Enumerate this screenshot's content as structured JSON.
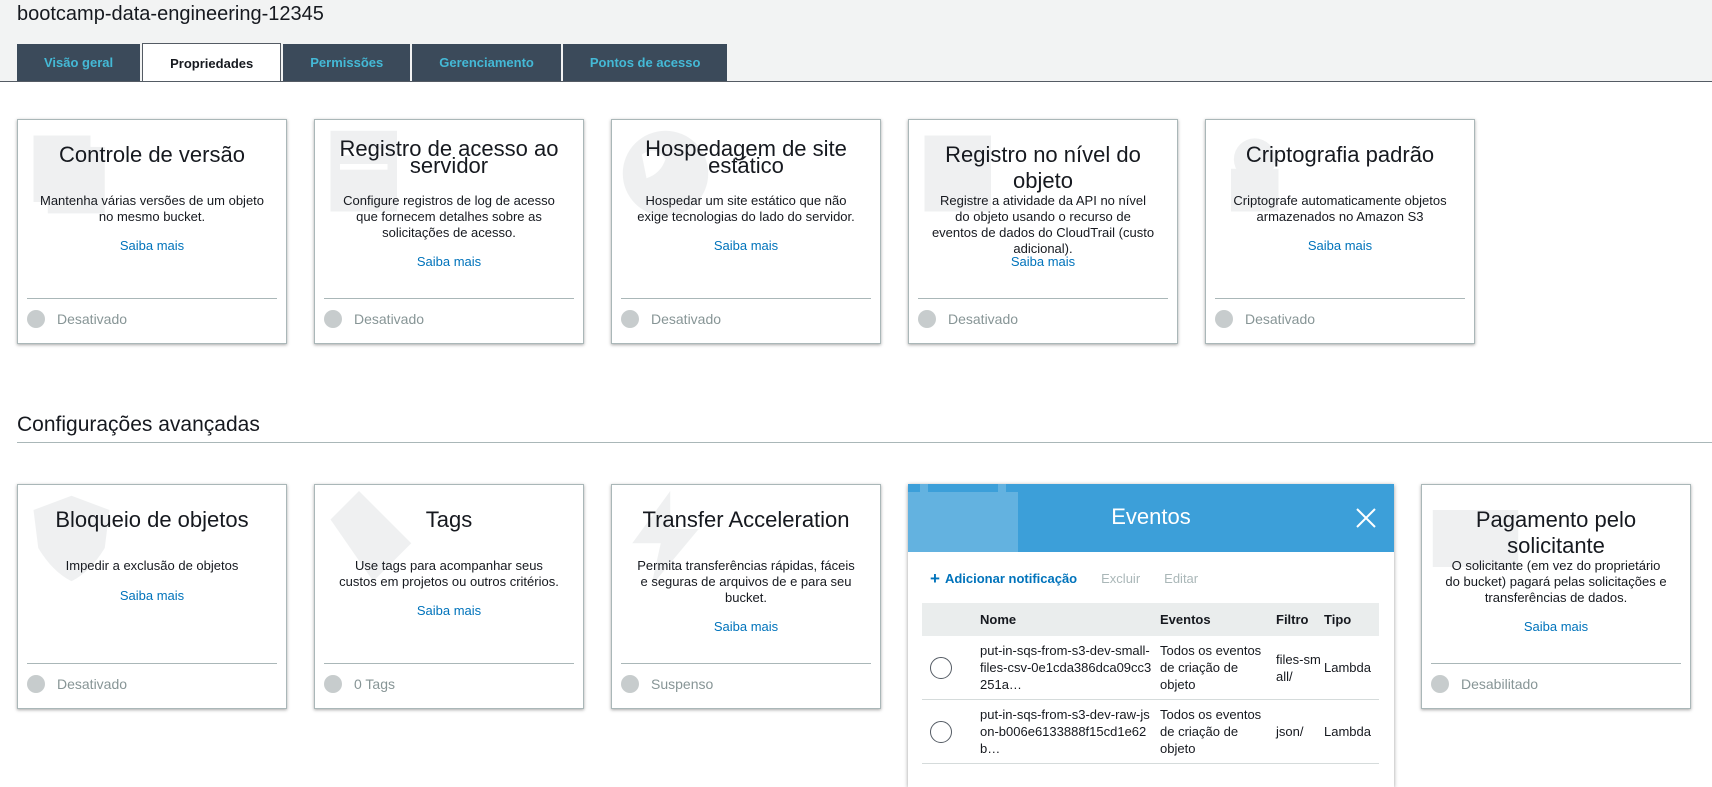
{
  "bucket_title": "bootcamp-data-engineering-12345",
  "tabs": [
    {
      "label": "Visão geral"
    },
    {
      "label": "Propriedades"
    },
    {
      "label": "Permissões"
    },
    {
      "label": "Gerenciamento"
    },
    {
      "label": "Pontos de acesso"
    }
  ],
  "active_tab": "Propriedades",
  "cards_top": [
    {
      "title": "Controle de versão",
      "desc": "Mantenha várias versões de um objeto no mesmo bucket.",
      "link": "Saiba mais",
      "status": "Desativado",
      "icon": "versions-icon"
    },
    {
      "title": "Registro de acesso ao servidor",
      "desc": "Configure registros de log de acesso que fornecem detalhes sobre as solicitações de acesso.",
      "link": "Saiba mais",
      "status": "Desativado",
      "icon": "log-icon"
    },
    {
      "title": "Hospedagem de site estático",
      "desc": "Hospedar um site estático que não exige tecnologias do lado do servidor.",
      "link": "Saiba mais",
      "status": "Desativado",
      "icon": "globe-icon"
    },
    {
      "title": "Registro no nível do objeto",
      "desc": "Registre a atividade da API no nível do objeto usando o recurso de eventos de dados do CloudTrail (custo adicional).",
      "link": "Saiba mais",
      "status": "Desativado",
      "icon": "object-log-icon"
    },
    {
      "title": "Criptografia padrão",
      "desc": "Criptografe automaticamente objetos armazenados no Amazon S3",
      "link": "Saiba mais",
      "status": "Desativado",
      "icon": "encryption-icon"
    }
  ],
  "advanced_title": "Configurações avançadas",
  "cards_bottom": [
    {
      "title": "Bloqueio de objetos",
      "desc": "Impedir a exclusão de objetos",
      "link": "Saiba mais",
      "status": "Desativado",
      "icon": "shield-icon"
    },
    {
      "title": "Tags",
      "desc": "Use tags para acompanhar seus custos em projetos ou outros critérios.",
      "link": "Saiba mais",
      "status": "0 Tags",
      "icon": "tag-icon"
    },
    {
      "title": "Transfer Acceleration",
      "desc": "Permita transferências rápidas, fáceis e seguras de arquivos de e para seu bucket.",
      "link": "Saiba mais",
      "status": "Suspenso",
      "icon": "lightning-icon"
    },
    {
      "title": "Pagamento pelo solicitante",
      "desc": "O solicitante (em vez do proprietário do bucket) pagará pelas solicitações e transferências de dados.",
      "link": "Saiba mais",
      "status": "Desabilitado",
      "icon": "payment-icon"
    }
  ],
  "events_panel": {
    "title": "Eventos",
    "add_label": "Adicionar notificação",
    "delete_label": "Excluir",
    "edit_label": "Editar",
    "columns": [
      "Nome",
      "Eventos",
      "Filtro",
      "Tipo"
    ],
    "rows": [
      {
        "name": "put-in-sqs-from-s3-dev-small-files-csv-0e1cda386dca09cc3251a…",
        "events": "Todos os eventos de criação de objeto",
        "filter": "files-small/",
        "type": "Lambda"
      },
      {
        "name": "put-in-sqs-from-s3-dev-raw-json-b006e6133888f15cd1e62b…",
        "events": "Todos os eventos de criação de objeto",
        "filter": "json/",
        "type": "Lambda"
      }
    ],
    "header_color": "#3c9fd9"
  },
  "colors": {
    "link": "#0073bb",
    "tab_bg": "#3b4a5a",
    "tab_text": "#44b9d6",
    "status_dot": "#c7cccd"
  }
}
